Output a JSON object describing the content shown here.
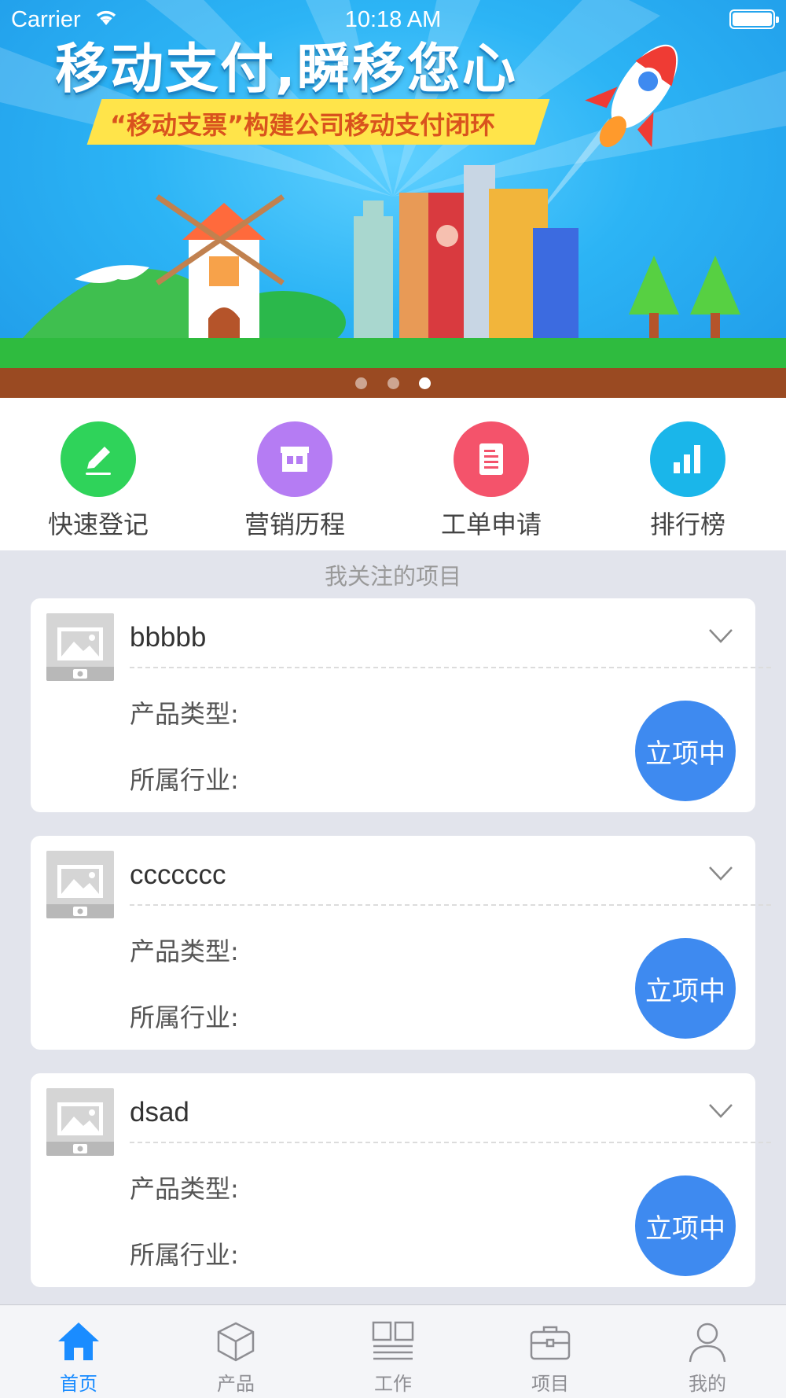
{
  "status_bar": {
    "carrier": "Carrier",
    "time": "10:18 AM"
  },
  "banner": {
    "headline": "移动支付,瞬移您心",
    "subline": "“移动支票”构建公司移动支付闭环",
    "page_count": 3,
    "active_page": 3
  },
  "quick_actions": [
    {
      "label": "快速登记",
      "icon": "pencil-icon",
      "color": "#2fd35a"
    },
    {
      "label": "营销历程",
      "icon": "store-icon",
      "color": "#b57cf3"
    },
    {
      "label": "工单申请",
      "icon": "document-icon",
      "color": "#f4536b"
    },
    {
      "label": "排行榜",
      "icon": "bar-chart-icon",
      "color": "#1ab6ea"
    }
  ],
  "section": {
    "title": "我关注的项目"
  },
  "projects": [
    {
      "name": "bbbbb",
      "product_type_label": "产品类型:",
      "industry_label": "所属行业:",
      "status": "立项中"
    },
    {
      "name": "ccccccc",
      "product_type_label": "产品类型:",
      "industry_label": "所属行业:",
      "status": "立项中"
    },
    {
      "name": "dsad",
      "product_type_label": "产品类型:",
      "industry_label": "所属行业:",
      "status": "立项中"
    }
  ],
  "tabbar": {
    "active": "首页",
    "items": [
      {
        "label": "首页",
        "icon": "home-icon"
      },
      {
        "label": "产品",
        "icon": "cube-icon"
      },
      {
        "label": "工作",
        "icon": "grid-icon"
      },
      {
        "label": "项目",
        "icon": "briefcase-icon"
      },
      {
        "label": "我的",
        "icon": "person-icon"
      }
    ]
  },
  "colors": {
    "accent": "#1a8cff",
    "status_badge": "#3e8af0",
    "background": "#e2e4ec"
  }
}
